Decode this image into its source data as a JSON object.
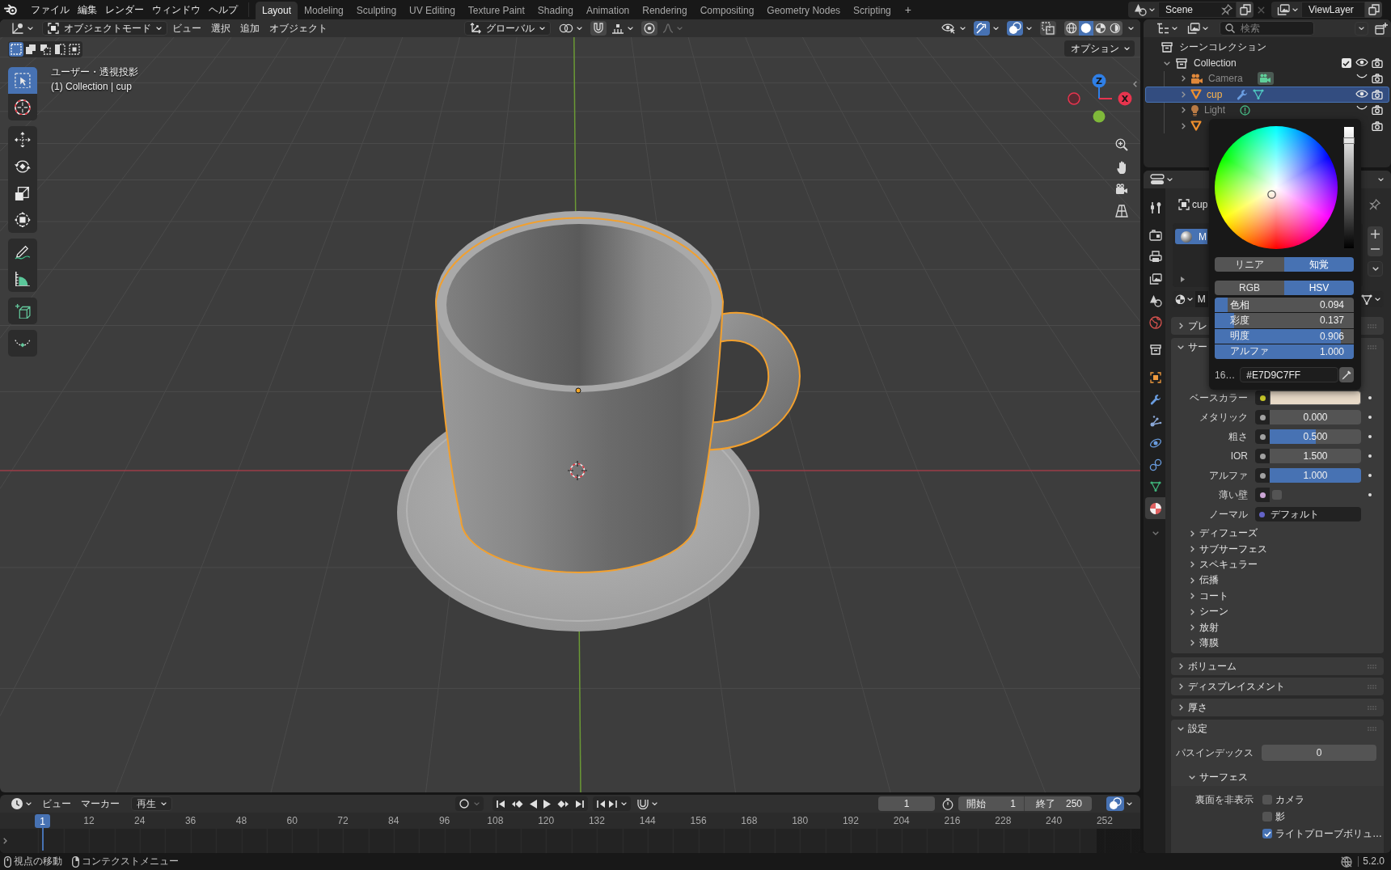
{
  "topbar": {
    "menus": [
      "ファイル",
      "編集",
      "レンダー",
      "ウィンドウ",
      "ヘルプ"
    ],
    "workspaces": [
      {
        "label": "Layout",
        "selected": true
      },
      {
        "label": "Modeling",
        "selected": false
      },
      {
        "label": "Sculpting",
        "selected": false
      },
      {
        "label": "UV Editing",
        "selected": false
      },
      {
        "label": "Texture Paint",
        "selected": false
      },
      {
        "label": "Shading",
        "selected": false
      },
      {
        "label": "Animation",
        "selected": false
      },
      {
        "label": "Rendering",
        "selected": false
      },
      {
        "label": "Compositing",
        "selected": false
      },
      {
        "label": "Geometry Nodes",
        "selected": false
      },
      {
        "label": "Scripting",
        "selected": false
      }
    ],
    "add_workspace": "+",
    "scene": "Scene",
    "view_layer": "ViewLayer"
  },
  "viewport": {
    "mode": "オブジェクトモード",
    "menus": [
      "ビュー",
      "選択",
      "追加",
      "オブジェクト"
    ],
    "orientation": "グローバル",
    "toggles": [
      {
        "kind": "visibility",
        "on": false
      },
      {
        "kind": "gizmo",
        "on": true
      },
      {
        "kind": "overlay",
        "on": true
      },
      {
        "kind": "xray",
        "on": false
      }
    ],
    "shading": [
      {
        "kind": "wireframe",
        "selected": false
      },
      {
        "kind": "solid",
        "selected": true
      },
      {
        "kind": "material",
        "selected": false
      },
      {
        "kind": "rendered",
        "selected": false
      }
    ],
    "select_modes": [
      {
        "kind": "set",
        "selected": true
      },
      {
        "kind": "extend",
        "selected": false
      },
      {
        "kind": "subtract",
        "selected": false
      },
      {
        "kind": "invert",
        "selected": false
      },
      {
        "kind": "intersect",
        "selected": false
      }
    ],
    "options": "オプション",
    "view_name": "ユーザー・透視投影",
    "object_info": "(1) Collection | cup",
    "tool_groups": [
      {
        "tools": [
          {
            "kind": "select_box",
            "selected": true
          },
          {
            "kind": "cursor",
            "selected": false
          }
        ]
      },
      {
        "tools": [
          {
            "kind": "move",
            "selected": false
          },
          {
            "kind": "rotate",
            "selected": false
          },
          {
            "kind": "scale",
            "selected": false
          },
          {
            "kind": "transform",
            "selected": false
          }
        ]
      },
      {
        "tools": [
          {
            "kind": "annotate",
            "selected": false
          },
          {
            "kind": "measure",
            "selected": false
          }
        ]
      },
      {
        "tools": [
          {
            "kind": "add_cube",
            "selected": false
          }
        ]
      },
      {
        "tools": [
          {
            "kind": "curve_points",
            "selected": false
          }
        ]
      }
    ],
    "gizmo_axes": [
      {
        "label": "Z",
        "color": "#2f7fe6"
      },
      {
        "label": "X",
        "color": "#e8344e"
      }
    ]
  },
  "timeline": {
    "menus": [
      "ビュー",
      "マーカー"
    ],
    "playback": "再生",
    "auto_key": false,
    "sync_view": true,
    "current_frame": "1",
    "start_label": "開始",
    "start": "1",
    "end_label": "終了",
    "end": "250",
    "playhead": "1",
    "ruler": [
      "12",
      "24",
      "36",
      "48",
      "60",
      "72",
      "84",
      "96",
      "108",
      "120",
      "132",
      "144",
      "156",
      "168",
      "180",
      "192",
      "204",
      "216",
      "228",
      "240",
      "252"
    ]
  },
  "status_bar": {
    "hints": [
      {
        "kind": "middle_click",
        "label": "視点の移動"
      },
      {
        "kind": "right_click",
        "label": "コンテクストメニュー"
      }
    ],
    "version": "5.2.0"
  },
  "outliner": {
    "search": {
      "placeholder": "検索"
    },
    "root": "シーンコレクション",
    "items": [
      {
        "label": "Collection",
        "kind": "collection",
        "expanded": true,
        "included": true,
        "visible": true,
        "children": [
          {
            "label": "Camera",
            "kind": "camera",
            "expanded": false,
            "selected": false,
            "visible": false,
            "has_modifier": false
          },
          {
            "label": "cup",
            "kind": "mesh",
            "expanded": false,
            "selected": true,
            "visible": true,
            "has_modifier": true
          },
          {
            "label": "Light",
            "kind": "light",
            "expanded": false,
            "selected": false,
            "visible": false,
            "has_modifier": false
          },
          {
            "kind": "mesh",
            "expanded": false,
            "selected": false
          }
        ]
      }
    ]
  },
  "properties": {
    "tab_groups": [
      {
        "tabs": [
          {
            "kind": "tool",
            "selected": false
          }
        ]
      },
      {
        "tabs": [
          {
            "kind": "render",
            "selected": false
          },
          {
            "kind": "output",
            "selected": false
          },
          {
            "kind": "view_layer",
            "selected": false
          },
          {
            "kind": "scene",
            "selected": false
          },
          {
            "kind": "world",
            "selected": false
          }
        ]
      },
      {
        "tabs": [
          {
            "kind": "collection",
            "selected": false
          }
        ]
      },
      {
        "tabs": [
          {
            "kind": "object",
            "selected": false
          },
          {
            "kind": "modifiers",
            "selected": false
          },
          {
            "kind": "particles",
            "selected": false
          },
          {
            "kind": "physics",
            "selected": false
          },
          {
            "kind": "constraints",
            "selected": false
          },
          {
            "kind": "data",
            "selected": false
          },
          {
            "kind": "material",
            "selected": true
          }
        ]
      }
    ],
    "object_name": "cup",
    "slots": [
      {
        "label": "M",
        "selected": true
      }
    ],
    "material_name": "M",
    "top_panels": [
      {
        "label": "プレ",
        "expanded": false
      },
      {
        "label": "サー",
        "expanded": true
      }
    ],
    "inputs": [
      {
        "label": "ベースカラー",
        "kind": "color",
        "color": "#c7c729",
        "swatch": {
          "color": "#e7d9c7"
        },
        "decorator": true
      },
      {
        "label": "メタリック",
        "kind": "number",
        "color": "#a1a1a1",
        "value": "0.000",
        "decorator": true
      },
      {
        "label": "粗さ",
        "kind": "slider",
        "color": "#a1a1a1",
        "value": "0.500",
        "level": 0.5,
        "decorator": true
      },
      {
        "label": "IOR",
        "kind": "number",
        "color": "#a1a1a1",
        "value": "1.500",
        "decorator": true
      },
      {
        "label": "アルファ",
        "kind": "slider",
        "color": "#a1a1a1",
        "value": "1.000",
        "level": 1,
        "decorator": true
      },
      {
        "label": "薄い壁",
        "kind": "checkbox",
        "color": "#cca6d6",
        "checked": false,
        "decorator": true
      },
      {
        "label": "ノーマル",
        "kind": "link",
        "color": "#6363c7",
        "value": "デフォルト",
        "decorator": false
      }
    ],
    "subpanels": [
      {
        "label": "ディフューズ",
        "expanded": false
      },
      {
        "label": "サブサーフェス",
        "expanded": false
      },
      {
        "label": "スペキュラー",
        "expanded": false
      },
      {
        "label": "伝播",
        "expanded": false
      },
      {
        "label": "コート",
        "expanded": false
      },
      {
        "label": "シーン",
        "expanded": false
      },
      {
        "label": "放射",
        "expanded": false
      },
      {
        "label": "薄膜",
        "expanded": false
      }
    ],
    "panels": [
      {
        "label": "ボリューム",
        "expanded": false
      },
      {
        "label": "ディスプレイスメント",
        "expanded": false
      },
      {
        "label": "厚さ",
        "expanded": false
      },
      {
        "label": "設定",
        "expanded": true
      }
    ],
    "settings": {
      "pass_index_label": "パスインデックス",
      "pass_index": "0",
      "surface": {
        "label": "サーフェス",
        "expanded": true
      },
      "backface_label": "裏面を非表示",
      "backface_options": [
        {
          "label": "カメラ",
          "checked": false
        },
        {
          "label": "影",
          "checked": false
        },
        {
          "label": "ライトプローブボリュ…",
          "checked": true
        }
      ]
    }
  },
  "color_picker": {
    "transfer": [
      {
        "label": "リニア",
        "selected": false
      },
      {
        "label": "知覚",
        "selected": true
      }
    ],
    "models": [
      {
        "label": "RGB",
        "selected": false
      },
      {
        "label": "HSV",
        "selected": true
      }
    ],
    "value_slider": {
      "level": 0.906
    },
    "fields": [
      {
        "label": "色相",
        "value": "0.094",
        "level": 0.094
      },
      {
        "label": "彩度",
        "value": "0.137",
        "level": 0.137
      },
      {
        "label": "明度",
        "value": "0.906",
        "level": 0.906
      },
      {
        "label": "アルファ",
        "value": "1.000",
        "level": 1
      }
    ],
    "hex_label": "16…",
    "hex": "#E7D9C7FF"
  }
}
